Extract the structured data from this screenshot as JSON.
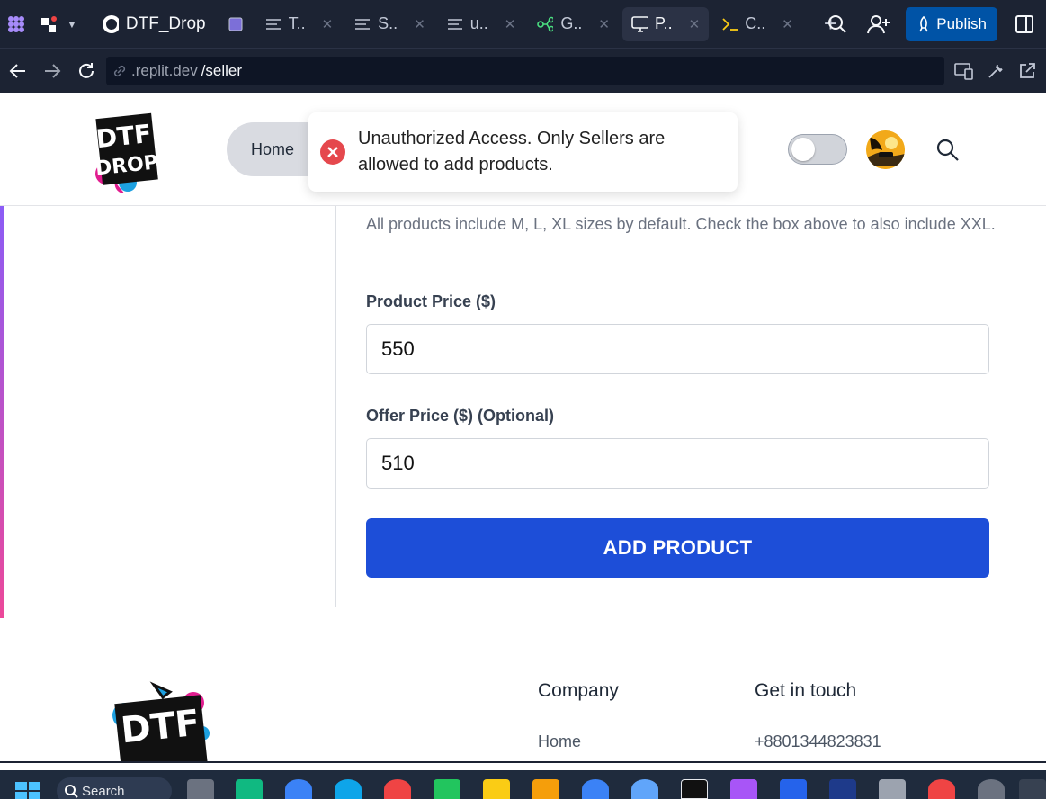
{
  "replit": {
    "project_name": "DTF_Drop",
    "tabs": [
      {
        "label": "T..",
        "icon": "file-lines-icon"
      },
      {
        "label": "S..",
        "icon": "file-lines-icon"
      },
      {
        "label": "u..",
        "icon": "file-lines-icon"
      },
      {
        "label": "G..",
        "icon": "git-branch-icon"
      },
      {
        "label": "P..",
        "icon": "monitor-icon",
        "active": true
      },
      {
        "label": "C..",
        "icon": "terminal-icon"
      }
    ],
    "publish_label": "Publish",
    "url_domain": ".replit.dev",
    "url_path": "/seller"
  },
  "header": {
    "nav_home": "Home"
  },
  "toast": {
    "message": "Unauthorized Access. Only Sellers are allowed to add products."
  },
  "form": {
    "size_hint": "All products include M, L, XL sizes by default. Check the box above to also include XXL.",
    "price_label": "Product Price ($)",
    "price_value": "550",
    "offer_label": "Offer Price ($) (Optional)",
    "offer_value": "510",
    "submit_label": "ADD PRODUCT"
  },
  "footer": {
    "company_heading": "Company",
    "company_link_1": "Home",
    "contact_heading": "Get in touch",
    "phone": "+8801344823831"
  },
  "taskbar": {
    "search_label": "Search"
  },
  "colors": {
    "primary_button": "#1d4ed8",
    "publish_button": "#0053a6",
    "error": "#e5484d",
    "replit_bar": "#1c2333"
  }
}
